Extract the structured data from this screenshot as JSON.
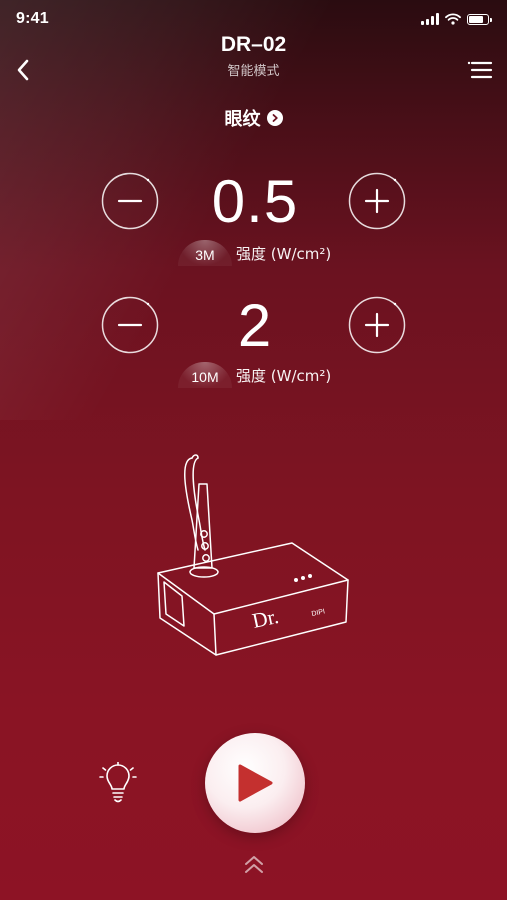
{
  "status_bar": {
    "time": "9:41",
    "signal_bars": 4,
    "battery_level": 0.9
  },
  "header": {
    "title": "DR–02",
    "subtitle": "智能模式",
    "back_icon": "chevron-left-icon",
    "menu_icon": "menu-icon"
  },
  "mode": {
    "label": "眼纹",
    "icon": "chevron-right-circle-icon"
  },
  "controls": [
    {
      "value": "0.5",
      "frequency": "3M",
      "unit": "强度 (W/cm²)",
      "minus_icon": "minus-circle-icon",
      "plus_icon": "plus-circle-icon"
    },
    {
      "value": "2",
      "frequency": "10M",
      "unit": "强度 (W/cm²)",
      "minus_icon": "minus-circle-icon",
      "plus_icon": "plus-circle-icon"
    }
  ],
  "device": {
    "brand_text": "Dr.",
    "small_text": "DIPI",
    "icon": "device-illustration"
  },
  "footer": {
    "light_icon": "lightbulb-icon",
    "play_icon": "play-icon",
    "expand_icon": "double-chevron-up-icon"
  },
  "colors": {
    "background_top": "#2a0c10",
    "background_bottom": "#8d1325",
    "accent": "#c4302f",
    "button_face": "#f6dfe3"
  }
}
